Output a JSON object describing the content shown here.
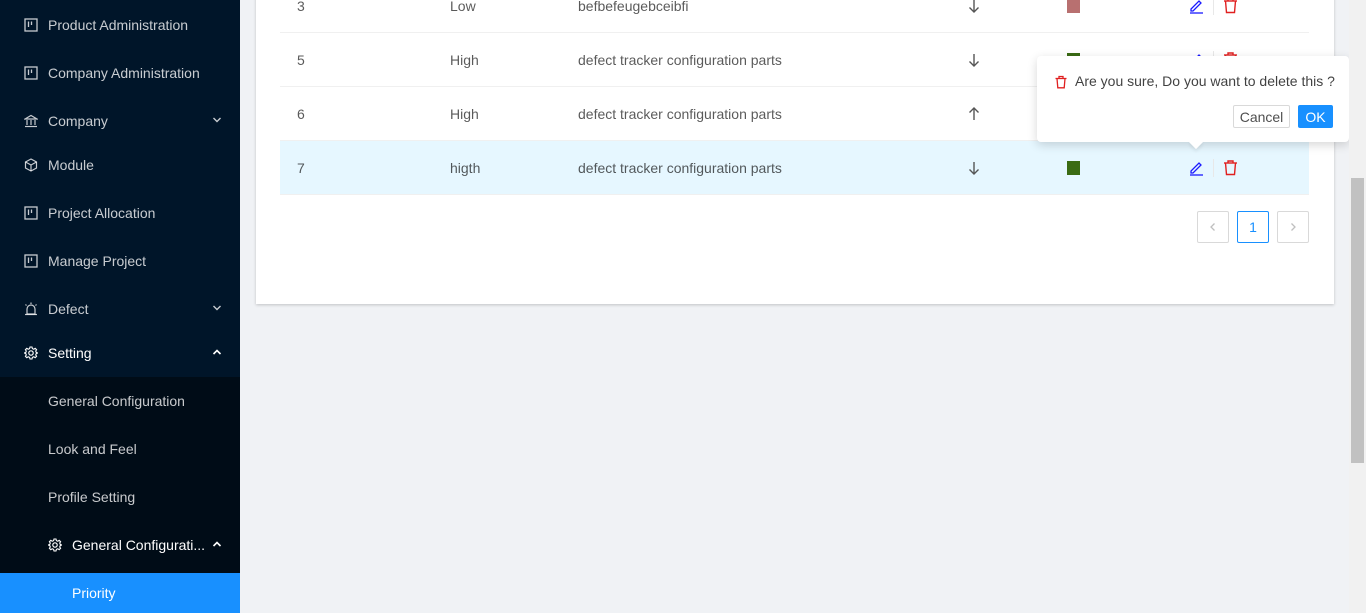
{
  "sidebar": {
    "items": [
      {
        "label": "Product Administration",
        "icon": "project-icon"
      },
      {
        "label": "Company Administration",
        "icon": "project-icon"
      },
      {
        "label": "Company",
        "icon": "bank-icon"
      },
      {
        "label": "Module",
        "icon": "cube-icon"
      },
      {
        "label": "Project Allocation",
        "icon": "project-icon"
      },
      {
        "label": "Manage Project",
        "icon": "project-icon"
      },
      {
        "label": "Defect",
        "icon": "alarm-icon"
      },
      {
        "label": "Setting",
        "icon": "gear-icon"
      }
    ],
    "setting_sub": [
      {
        "label": "General Configuration"
      },
      {
        "label": "Look and Feel"
      },
      {
        "label": "Profile Setting"
      },
      {
        "label": "General Configurati..."
      }
    ],
    "selected": {
      "label": "Priority"
    }
  },
  "table": {
    "rows": [
      {
        "id": "3",
        "name": "Low",
        "description": "befbefeugebceibfi",
        "direction": "down",
        "color": "#b87070"
      },
      {
        "id": "5",
        "name": "High",
        "description": "defect tracker configuration parts",
        "direction": "down",
        "color": "#3a6b14"
      },
      {
        "id": "6",
        "name": "High",
        "description": "defect tracker configuration parts",
        "direction": "up",
        "color": "#3a6b14"
      },
      {
        "id": "7",
        "name": "higth",
        "description": "defect tracker configuration parts",
        "direction": "down",
        "color": "#3a6b14"
      }
    ]
  },
  "pagination": {
    "current": "1"
  },
  "popconfirm": {
    "message": "Are you sure, Do you want to delete this ?",
    "cancel_label": "Cancel",
    "ok_label": "OK"
  }
}
